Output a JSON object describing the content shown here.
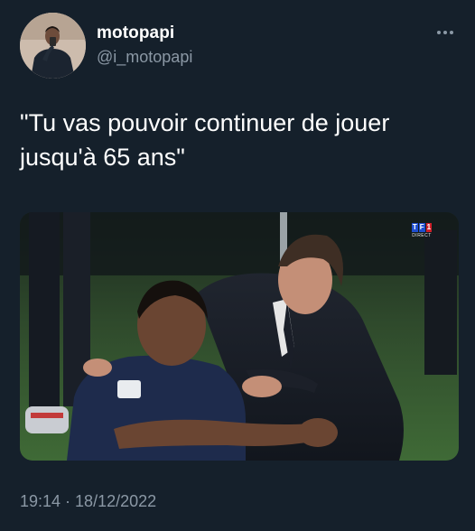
{
  "author": {
    "display_name": "motopapi",
    "handle": "@i_motopapi"
  },
  "tweet": {
    "text": "\"Tu vas pouvoir continuer de jouer\njusqu'à 65 ans\"",
    "time": "19:14",
    "separator": " · ",
    "date": "18/12/2022"
  },
  "media": {
    "broadcaster_logo": [
      "T",
      "F",
      "1"
    ],
    "broadcaster_tag": "DIRECT"
  },
  "icons": {
    "more": "more-horizontal-icon"
  },
  "colors": {
    "background": "#15202b",
    "primary_text": "#ffffff",
    "secondary_text": "#8b98a5"
  }
}
